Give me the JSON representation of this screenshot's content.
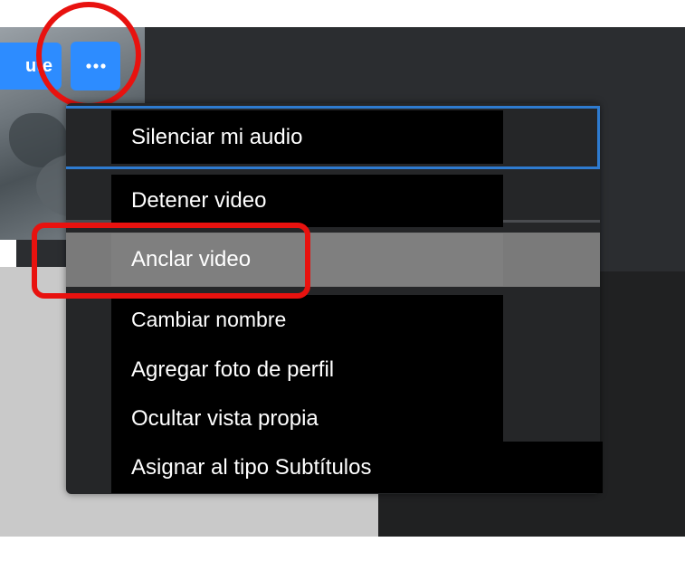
{
  "toolbar": {
    "mute_label": "ute",
    "more_icon": "ellipsis-icon"
  },
  "menu": {
    "items": [
      {
        "label": "Silenciar mi audio"
      },
      {
        "label": "Detener video"
      },
      {
        "label": "Anclar video"
      },
      {
        "label": "Cambiar nombre"
      },
      {
        "label": "Agregar foto de perfil"
      },
      {
        "label": "Ocultar vista propia"
      },
      {
        "label": "Asignar al tipo Subtítulos"
      }
    ]
  },
  "colors": {
    "accent_blue": "#2d8cff",
    "highlight_red": "#e8120f",
    "selection_blue": "#2e7bd0"
  }
}
